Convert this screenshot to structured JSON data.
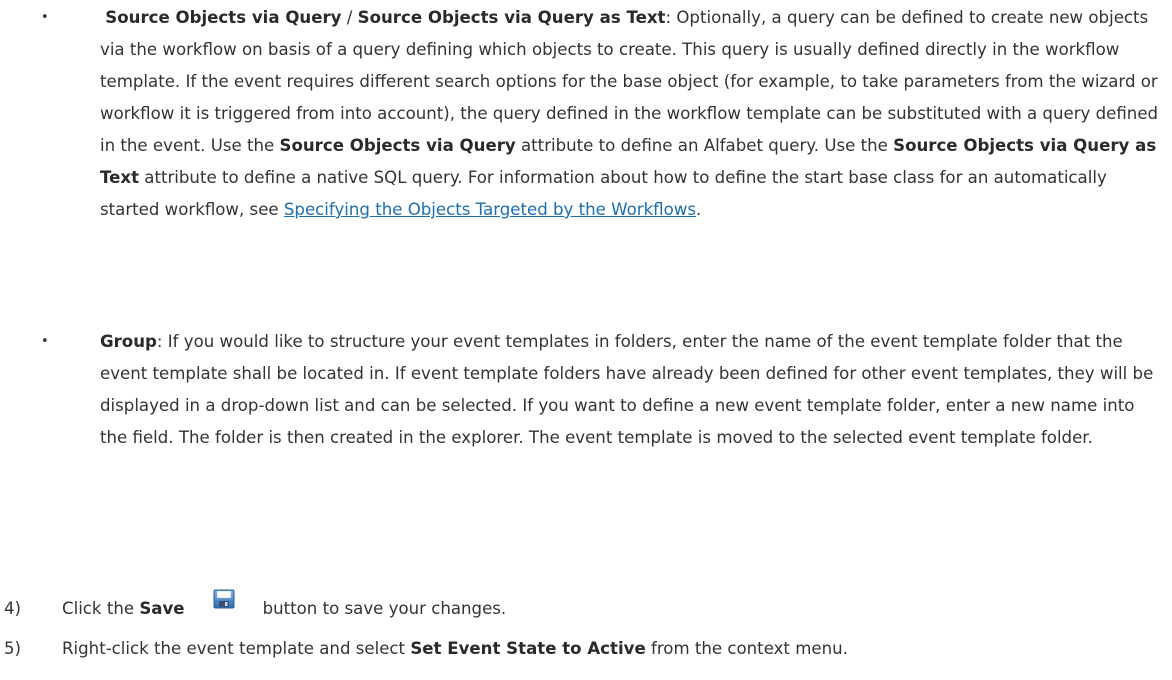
{
  "bullets": [
    {
      "bullet_char": "•",
      "term_a": "Source Objects via Query",
      "separator": " / ",
      "term_b": "Source Objects via Query as Text",
      "colon": ":",
      "text_1": " Optionally, a query can be defined to create new objects via the workflow on basis of a query defining which objects to create. This query is usually defined directly in the workflow template. If the event requires different search options for the base object (for example, to take parameters from the wizard or workflow it is triggered from into account), the query defined in the workflow template can be substituted with a query defined in the event. Use the ",
      "term_c": "Source Objects via Query",
      "text_2": " attribute to define an Alfabet query. Use the ",
      "term_d": "Source Objects via Query as Text",
      "text_3": " attribute to define a native SQL query. For information about how to define the start base class for an automatically started workflow, see ",
      "link_text": "Specifying the Objects Targeted by the Workflows",
      "text_4": "."
    },
    {
      "bullet_char": "•",
      "term": "Group",
      "colon": ":",
      "text": " If you would like to structure your event templates in folders, enter the name of the event template folder that the event template shall be located in. If event template folders have already been defined for other event templates, they will be displayed in a drop-down list and can be selected. If you want to define a new event template folder, enter a new name into the field. The folder is then created in the explorer. The event template is moved to the selected event template folder."
    }
  ],
  "steps": [
    {
      "number": "4)",
      "text_before": "Click the ",
      "bold": "Save",
      "icon": "save-icon",
      "text_after": "button to save your changes."
    },
    {
      "number": "5)",
      "text_before": "Right-click the event template and select ",
      "bold": "Set Event State to Active",
      "text_after": " from the context menu."
    }
  ]
}
